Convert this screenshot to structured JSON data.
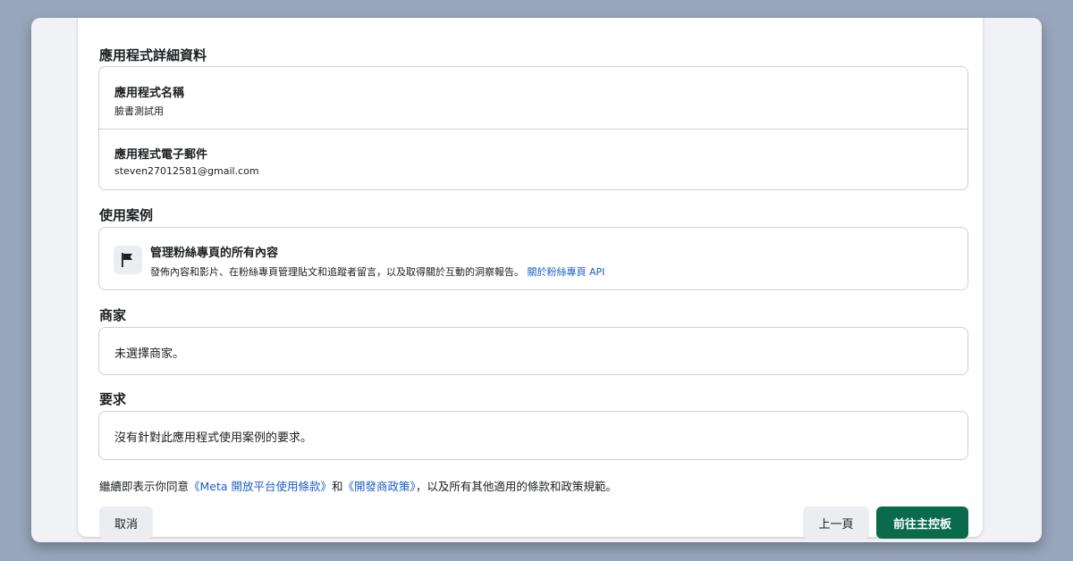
{
  "app_details": {
    "title": "應用程式詳細資料",
    "name_label": "應用程式名稱",
    "name_value": "臉書測試用",
    "email_label": "應用程式電子郵件",
    "email_value": "steven27012581@gmail.com"
  },
  "use_cases": {
    "title": "使用案例",
    "item": {
      "icon": "flag-icon",
      "title": "管理粉絲專頁的所有內容",
      "description": "發佈內容和影片、在粉絲專頁管理貼文和追蹤者留言，以及取得關於互動的洞察報告。",
      "link": "關於粉絲專頁 API"
    }
  },
  "business": {
    "title": "商家",
    "value": "未選擇商家。"
  },
  "requirements": {
    "title": "要求",
    "value": "沒有針對此應用程式使用案例的要求。"
  },
  "terms": {
    "prefix": "繼續即表示你同意",
    "link1": "《Meta 開放平台使用條款》",
    "middle": "和",
    "link2": "《開發商政策》",
    "suffix": "，以及所有其他適用的條款和政策規範。"
  },
  "footer": {
    "cancel_label": "取消",
    "back_label": "上一頁",
    "go_label": "前往主控板"
  },
  "colors": {
    "primary_green": "#0a6b4c",
    "link_blue": "#1a5ec6",
    "backdrop": "#98a5bc"
  }
}
